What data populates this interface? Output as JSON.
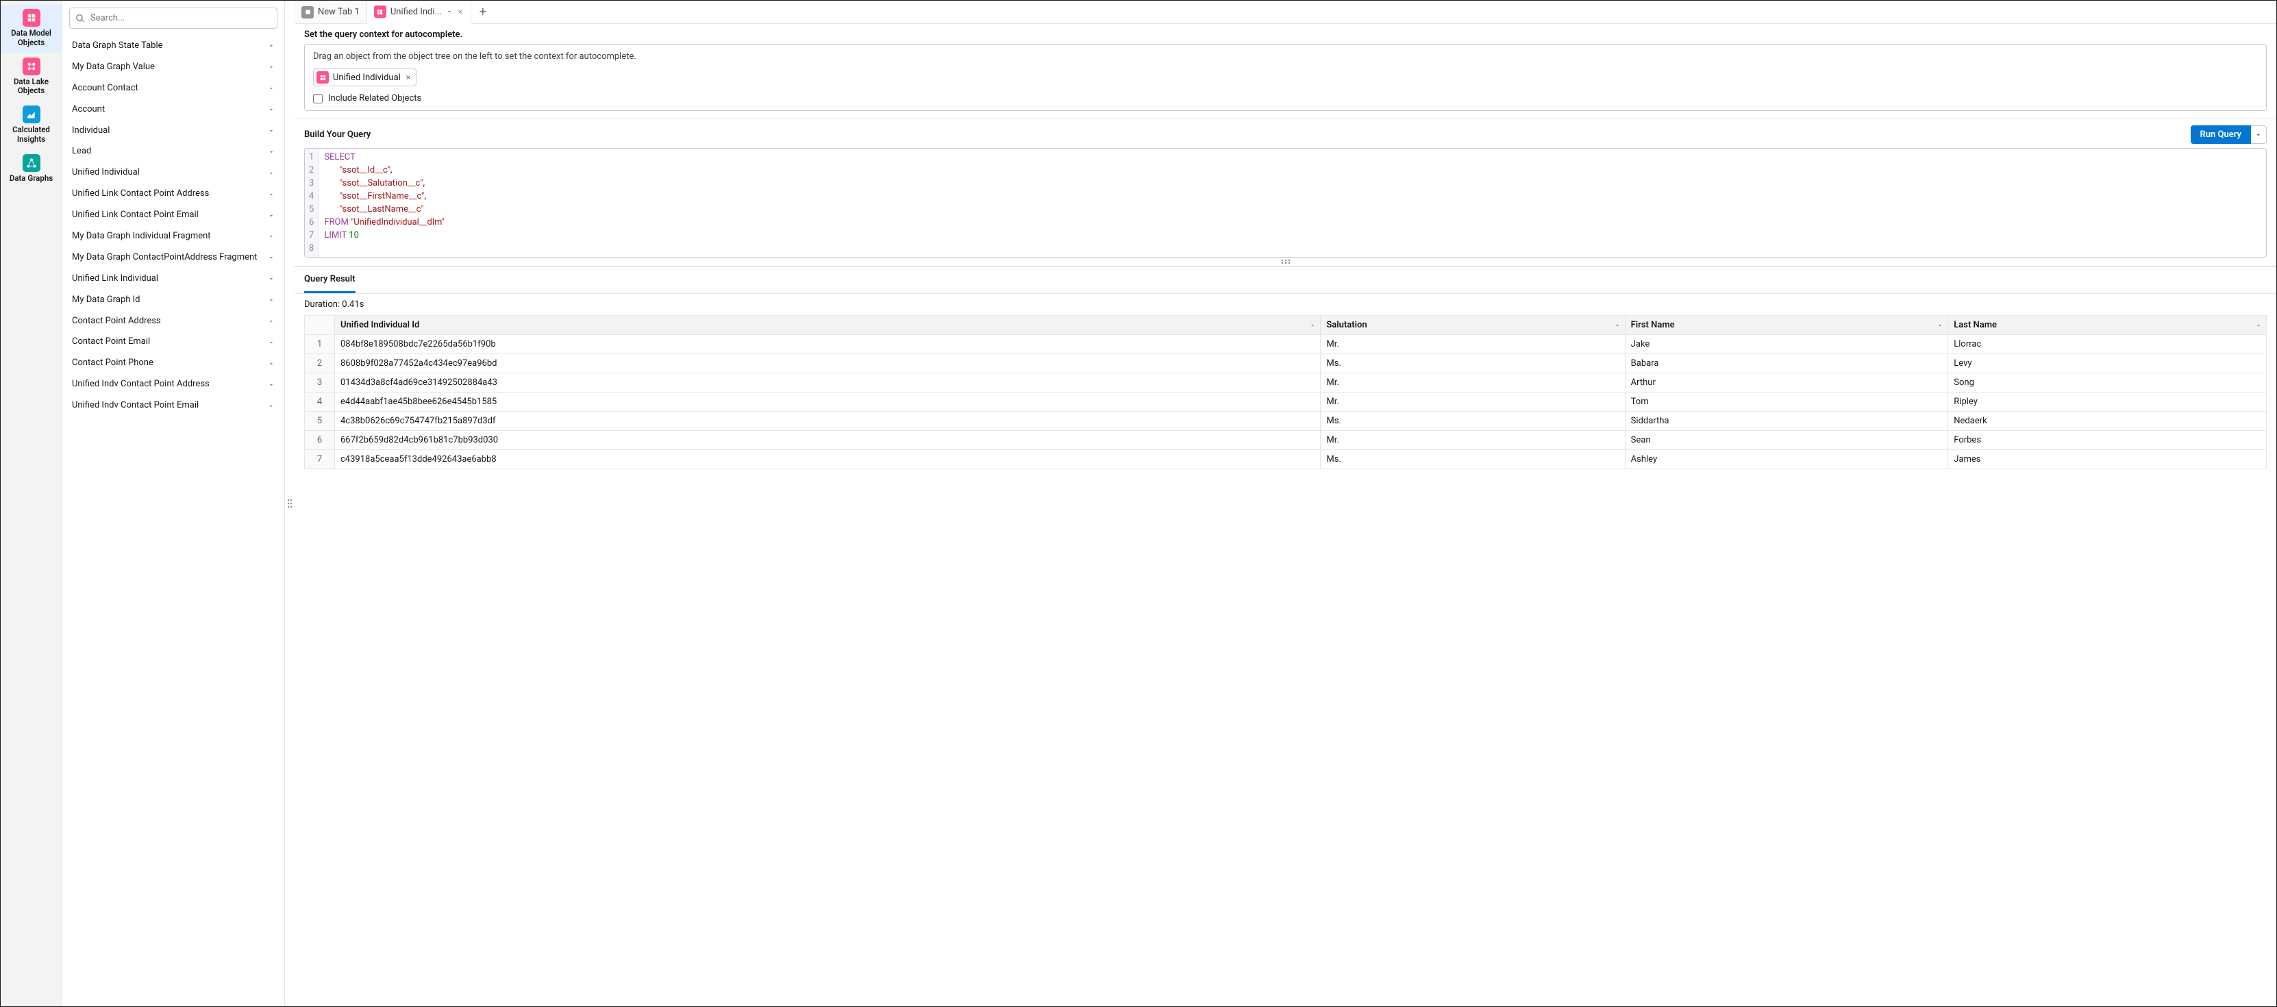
{
  "rail": [
    {
      "label": "Data Model Objects",
      "icon": "pink",
      "active": true
    },
    {
      "label": "Data Lake Objects",
      "icon": "pink",
      "active": false
    },
    {
      "label": "Calculated Insights",
      "icon": "blue",
      "active": false
    },
    {
      "label": "Data Graphs",
      "icon": "green",
      "active": false
    }
  ],
  "search": {
    "placeholder": "Search..."
  },
  "tree": [
    "Data Graph State Table",
    "My Data Graph Value",
    "Account Contact",
    "Account",
    "Individual",
    "Lead",
    "Unified Individual",
    "Unified Link Contact Point Address",
    "Unified Link Contact Point Email",
    "My Data Graph Individual Fragment",
    "My Data Graph ContactPointAddress Fragment",
    "Unified Link Individual",
    "My Data Graph Id",
    "Contact Point Address",
    "Contact Point Email",
    "Contact Point Phone",
    "Unified Indv Contact Point Address",
    "Unified Indv Contact Point Email"
  ],
  "tabs": [
    {
      "label": "New Tab 1",
      "icon": "gray",
      "active": false
    },
    {
      "label": "Unified Indi...",
      "icon": "pink",
      "active": true
    }
  ],
  "context": {
    "heading": "Set the query context for autocomplete.",
    "hint": "Drag an object from the object tree on the left to set the context for autocomplete.",
    "chip": "Unified Individual",
    "checkbox": "Include Related Objects"
  },
  "query": {
    "title": "Build Your Query",
    "run_label": "Run Query",
    "lines": [
      {
        "n": "1",
        "html": "<span class='kw'>SELECT</span>"
      },
      {
        "n": "2",
        "html": "       <span class='str'>\"ssot__Id__c\"</span>,"
      },
      {
        "n": "3",
        "html": "       <span class='str'>\"ssot__Salutation__c\"</span>,"
      },
      {
        "n": "4",
        "html": "       <span class='str'>\"ssot__FirstName__c\"</span>,"
      },
      {
        "n": "5",
        "html": "       <span class='str'>\"ssot__LastName__c\"</span>"
      },
      {
        "n": "6",
        "html": "<span class='kw'>FROM</span> <span class='str'>\"UnifiedIndividual__dlm\"</span>"
      },
      {
        "n": "7",
        "html": "<span class='kw'>LIMIT</span> <span class='num'>10</span>"
      },
      {
        "n": "8",
        "html": ""
      }
    ]
  },
  "results": {
    "tab": "Query Result",
    "duration": "Duration: 0.41s",
    "columns": [
      "",
      "Unified Individual Id",
      "Salutation",
      "First Name",
      "Last Name"
    ],
    "rows": [
      [
        "1",
        "084bf8e189508bdc7e2265da56b1f90b",
        "Mr.",
        "Jake",
        "Llorrac"
      ],
      [
        "2",
        "8608b9f028a77452a4c434ec97ea96bd",
        "Ms.",
        "Babara",
        "Levy"
      ],
      [
        "3",
        "01434d3a8cf4ad69ce31492502884a43",
        "Mr.",
        "Arthur",
        "Song"
      ],
      [
        "4",
        "e4d44aabf1ae45b8bee626e4545b1585",
        "Mr.",
        "Tom",
        "Ripley"
      ],
      [
        "5",
        "4c38b0626c69c754747fb215a897d3df",
        "Ms.",
        "Siddartha",
        "Nedaerk"
      ],
      [
        "6",
        "667f2b659d82d4cb961b81c7bb93d030",
        "Mr.",
        "Sean",
        "Forbes"
      ],
      [
        "7",
        "c43918a5ceaa5f13dde492643ae6abb8",
        "Ms.",
        "Ashley",
        "James"
      ]
    ]
  }
}
